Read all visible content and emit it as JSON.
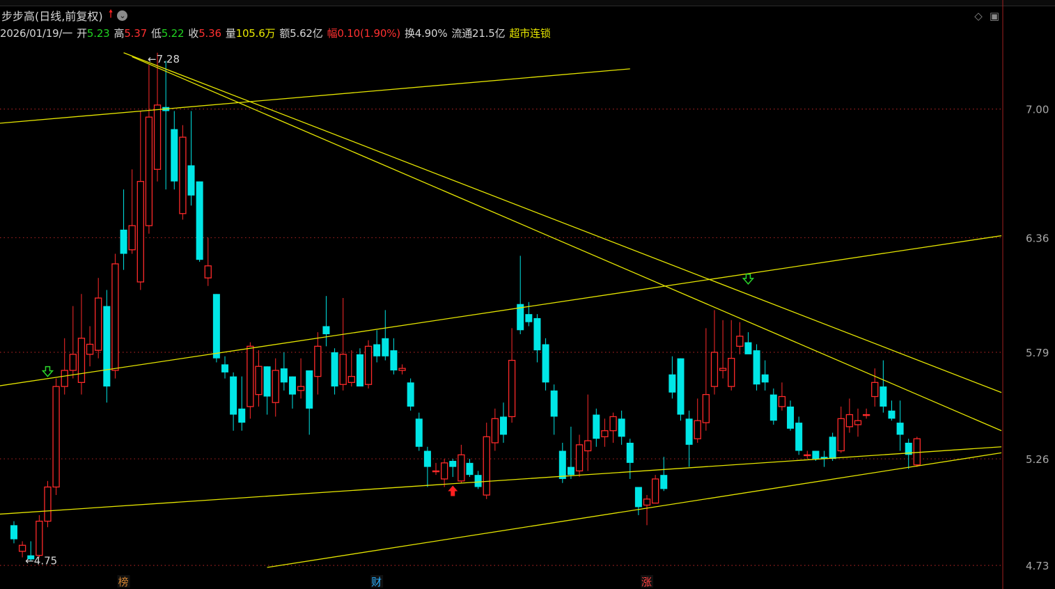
{
  "header": {
    "stock_name": "步步高",
    "period_label": "(日线,前复权)",
    "up_arrow_icon": "red-up-arrow-icon",
    "dropdown_icon": "circle-chevron-down-icon"
  },
  "info": {
    "date": "2026/01/19/一",
    "open_label": "开",
    "open_value": "5.23",
    "high_label": "高",
    "high_value": "5.37",
    "low_label": "低",
    "low_value": "5.22",
    "close_label": "收",
    "close_value": "5.36",
    "vol_label": "量",
    "vol_value": "105.6万",
    "amount_label": "额",
    "amount_value": "5.62亿",
    "change_label": "幅",
    "change_value": "0.10(1.90%)",
    "turnover_label": "换",
    "turnover_value": "4.90%",
    "float_label": "流通",
    "float_value": "21.5亿",
    "sector": "超市连锁"
  },
  "colors": {
    "up": "#ff2a2a",
    "down": "#00e6e6",
    "trendline": "#e6e600",
    "grid": "#a02020",
    "axis_text": "#a8a8a8"
  },
  "chart_data": {
    "type": "candlestick",
    "y_ticks": [
      "7.00",
      "6.36",
      "5.79",
      "5.26",
      "4.73"
    ],
    "y_tick_values": [
      7.0,
      6.36,
      5.79,
      5.26,
      4.73
    ],
    "ylim": [
      4.72,
      7.3
    ],
    "high_label": "7.28",
    "low_label": "4.75",
    "bottom_markers": [
      {
        "text": "榜",
        "index": 13,
        "color": "#d08030"
      },
      {
        "text": "财",
        "index": 43,
        "color": "#2ab0ff"
      },
      {
        "text": "涨",
        "index": 75,
        "color": "#ff4040"
      }
    ],
    "candles": [
      [
        4.93,
        4.86,
        4.95,
        4.84
      ],
      [
        4.8,
        4.83,
        4.85,
        4.77
      ],
      [
        4.78,
        4.76,
        4.85,
        4.75
      ],
      [
        4.78,
        4.95,
        4.98,
        4.77
      ],
      [
        4.95,
        5.12,
        5.15,
        4.92
      ],
      [
        5.12,
        5.62,
        5.66,
        5.08
      ],
      [
        5.62,
        5.7,
        5.86,
        5.58
      ],
      [
        5.7,
        5.78,
        6.02,
        5.66
      ],
      [
        5.64,
        5.86,
        6.08,
        5.58
      ],
      [
        5.78,
        5.83,
        5.92,
        5.72
      ],
      [
        5.8,
        6.06,
        6.16,
        5.76
      ],
      [
        6.02,
        5.62,
        6.1,
        5.54
      ],
      [
        5.7,
        6.23,
        6.28,
        5.66
      ],
      [
        6.4,
        6.28,
        6.6,
        6.2
      ],
      [
        6.3,
        6.42,
        6.7,
        6.28
      ],
      [
        6.14,
        6.64,
        6.99,
        6.1
      ],
      [
        6.42,
        6.96,
        7.22,
        6.38
      ],
      [
        6.7,
        7.02,
        7.28,
        6.64
      ],
      [
        7.01,
        6.99,
        7.24,
        6.6
      ],
      [
        6.9,
        6.64,
        6.99,
        6.6
      ],
      [
        6.48,
        6.86,
        6.92,
        6.45
      ],
      [
        6.72,
        6.57,
        6.99,
        6.52
      ],
      [
        6.64,
        6.25,
        6.64,
        6.24
      ],
      [
        6.16,
        6.22,
        6.36,
        6.12
      ],
      [
        6.08,
        5.76,
        6.08,
        5.74
      ],
      [
        5.73,
        5.69,
        5.77,
        5.66
      ],
      [
        5.67,
        5.48,
        5.69,
        5.4
      ],
      [
        5.51,
        5.44,
        5.67,
        5.4
      ],
      [
        5.52,
        5.82,
        5.84,
        5.46
      ],
      [
        5.58,
        5.72,
        5.8,
        5.52
      ],
      [
        5.72,
        5.57,
        5.72,
        5.48
      ],
      [
        5.54,
        5.7,
        5.76,
        5.47
      ],
      [
        5.71,
        5.64,
        5.79,
        5.6
      ],
      [
        5.67,
        5.58,
        5.67,
        5.51
      ],
      [
        5.6,
        5.62,
        5.76,
        5.56
      ],
      [
        5.7,
        5.51,
        5.7,
        5.38
      ],
      [
        5.67,
        5.82,
        5.89,
        5.58
      ],
      [
        5.92,
        5.88,
        6.07,
        5.82
      ],
      [
        5.79,
        5.62,
        5.81,
        5.58
      ],
      [
        5.63,
        5.78,
        6.06,
        5.6
      ],
      [
        5.64,
        5.67,
        5.8,
        5.62
      ],
      [
        5.78,
        5.62,
        5.81,
        5.64
      ],
      [
        5.63,
        5.82,
        5.85,
        5.61
      ],
      [
        5.83,
        5.77,
        5.9,
        5.74
      ],
      [
        5.86,
        5.77,
        6.0,
        5.75
      ],
      [
        5.8,
        5.7,
        5.86,
        5.68
      ],
      [
        5.7,
        5.71,
        5.73,
        5.68
      ],
      [
        5.64,
        5.52,
        5.66,
        5.5
      ],
      [
        5.46,
        5.32,
        5.49,
        5.3
      ],
      [
        5.3,
        5.22,
        5.32,
        5.12
      ],
      [
        5.2,
        5.2,
        5.24,
        5.18
      ],
      [
        5.16,
        5.24,
        5.26,
        5.12
      ],
      [
        5.25,
        5.22,
        5.26,
        5.17
      ],
      [
        5.15,
        5.28,
        5.33,
        5.14
      ],
      [
        5.24,
        5.18,
        5.26,
        5.17
      ],
      [
        5.18,
        5.12,
        5.2,
        5.11
      ],
      [
        5.08,
        5.37,
        5.44,
        5.06
      ],
      [
        5.34,
        5.46,
        5.51,
        5.3
      ],
      [
        5.47,
        5.38,
        5.54,
        5.34
      ],
      [
        5.47,
        5.75,
        5.91,
        5.44
      ],
      [
        6.03,
        5.9,
        6.27,
        5.88
      ],
      [
        5.98,
        5.94,
        6.04,
        5.92
      ],
      [
        5.96,
        5.8,
        5.98,
        5.74
      ],
      [
        5.83,
        5.64,
        5.86,
        5.6
      ],
      [
        5.6,
        5.47,
        5.63,
        5.38
      ],
      [
        5.3,
        5.16,
        5.34,
        5.14
      ],
      [
        5.22,
        5.18,
        5.42,
        5.16
      ],
      [
        5.2,
        5.33,
        5.38,
        5.17
      ],
      [
        5.3,
        5.35,
        5.58,
        5.2
      ],
      [
        5.48,
        5.36,
        5.51,
        5.32
      ],
      [
        5.37,
        5.4,
        5.46,
        5.32
      ],
      [
        5.4,
        5.47,
        5.49,
        5.34
      ],
      [
        5.46,
        5.37,
        5.5,
        5.33
      ],
      [
        5.34,
        5.24,
        5.36,
        5.16
      ],
      [
        5.12,
        5.02,
        5.12,
        4.98
      ],
      [
        5.03,
        5.06,
        5.08,
        4.93
      ],
      [
        5.04,
        5.16,
        5.18,
        5.04
      ],
      [
        5.18,
        5.11,
        5.27,
        5.1
      ],
      [
        5.68,
        5.59,
        5.77,
        5.56
      ],
      [
        5.76,
        5.48,
        5.76,
        5.45
      ],
      [
        5.46,
        5.33,
        5.5,
        5.22
      ],
      [
        5.36,
        5.45,
        5.56,
        5.34
      ],
      [
        5.44,
        5.58,
        5.91,
        5.4
      ],
      [
        5.62,
        5.79,
        6.0,
        5.58
      ],
      [
        5.7,
        5.71,
        5.95,
        5.66
      ],
      [
        5.62,
        5.76,
        5.95,
        5.6
      ],
      [
        5.82,
        5.87,
        5.94,
        5.78
      ],
      [
        5.84,
        5.78,
        5.89,
        5.8
      ],
      [
        5.8,
        5.63,
        5.83,
        5.6
      ],
      [
        5.68,
        5.64,
        5.75,
        5.6
      ],
      [
        5.58,
        5.45,
        5.61,
        5.43
      ],
      [
        5.52,
        5.57,
        5.64,
        5.5
      ],
      [
        5.52,
        5.41,
        5.55,
        5.4
      ],
      [
        5.44,
        5.3,
        5.47,
        5.28
      ],
      [
        5.28,
        5.28,
        5.3,
        5.26
      ],
      [
        5.3,
        5.26,
        5.3,
        5.25
      ],
      [
        5.27,
        5.26,
        5.3,
        5.22
      ],
      [
        5.37,
        5.26,
        5.39,
        5.25
      ],
      [
        5.3,
        5.46,
        5.52,
        5.29
      ],
      [
        5.42,
        5.48,
        5.56,
        5.39
      ],
      [
        5.43,
        5.45,
        5.51,
        5.37
      ],
      [
        5.48,
        5.48,
        5.51,
        5.46
      ],
      [
        5.57,
        5.64,
        5.71,
        5.52
      ],
      [
        5.62,
        5.52,
        5.75,
        5.49
      ],
      [
        5.5,
        5.46,
        5.55,
        5.45
      ],
      [
        5.44,
        5.38,
        5.55,
        5.3
      ],
      [
        5.34,
        5.28,
        5.36,
        5.21
      ],
      [
        5.23,
        5.36,
        5.37,
        5.22
      ]
    ],
    "trendlines": [
      {
        "p1": [
          -7,
          6.91
        ],
        "p2": [
          73,
          7.2
        ]
      },
      {
        "p1": [
          14,
          7.26
        ],
        "p2": [
          117,
          5.4
        ]
      },
      {
        "p1": [
          13,
          7.28
        ],
        "p2": [
          117,
          5.59
        ]
      },
      {
        "p1": [
          -7,
          5.59
        ],
        "p2": [
          117,
          6.37
        ]
      },
      {
        "p1": [
          -7,
          4.97
        ],
        "p2": [
          117,
          5.32
        ]
      },
      {
        "p1": [
          30,
          4.72
        ],
        "p2": [
          117,
          5.29
        ]
      }
    ],
    "signals": [
      {
        "type": "green-down-arrow",
        "index": 4,
        "price": 5.67
      },
      {
        "type": "green-down-arrow",
        "index": 87,
        "price": 6.13
      },
      {
        "type": "red-up-arrow",
        "index": 52,
        "price": 5.12
      }
    ]
  }
}
